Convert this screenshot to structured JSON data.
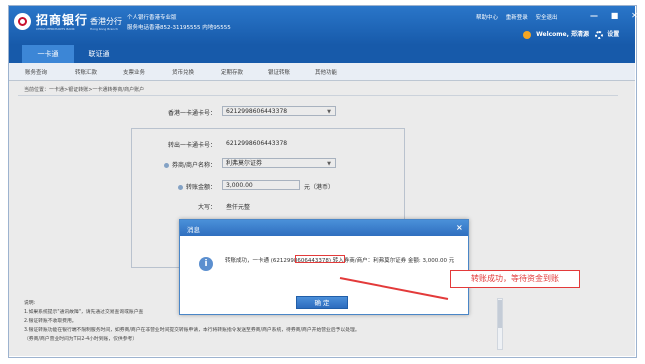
{
  "header": {
    "bank_name": "招商银行",
    "bank_name_en": "CHINA MERCHANTS BANK",
    "branch": "香港分行",
    "branch_en": "Hong Kong Branch",
    "portal_title": "个人银行香港专业版",
    "hotline": "服务电话香港852-31195555 内地95555",
    "top_links": [
      "帮助中心",
      "重新登录",
      "安全退出"
    ],
    "window_controls": "— ■ ✕",
    "welcome": "Welcome,",
    "user_name": "郑清源",
    "settings_label": "设置"
  },
  "tabs": {
    "main": [
      "一卡通",
      "联证通"
    ]
  },
  "subnav": {
    "items": [
      "账务查询",
      "转账汇款",
      "支票业务",
      "货币兑换",
      "定期存款",
      "银证转账",
      "其他功能"
    ]
  },
  "breadcrumb": "当前位置：一卡通>银证转账>一卡通转券商/商户账户",
  "form": {
    "card_label": "香港一卡通卡号：",
    "card_value": "6212998606443378",
    "out_card_label": "转出一卡通卡号：",
    "out_card_value": "6212998606443378",
    "broker_label": "券商/商户名称：",
    "broker_value": "利弗莫尔证券",
    "amount_label": "转账金额：",
    "amount_value": "3,000.00",
    "amount_unit": "元（港币）",
    "uppercase_label": "大写：",
    "uppercase_value": "叁仟元整"
  },
  "modal": {
    "title": "消息",
    "message": "转账成功，一卡通 (6212998606443378) 转入券商/商户：利弗莫尔证券 金额: 3,000.00 元",
    "ok_label": "确  定"
  },
  "callout": {
    "text": "转账成功，等待资金到账"
  },
  "notes": {
    "title": "说明:",
    "lines": [
      "1.如果系统提示\"通讯故障\"，请先通过交易查询或账户查",
      "2.银证转账不收取费用。",
      "3.银证转账功能在银行端不限制服务时间，如券商/商户在非营业时间提交转账申请，本行将转账指令发送至券商/商户系统，待券商/商户开始营业后予以处理。",
      "（券商/商户营业时间为T日2-4小时到账，仅供参考）"
    ]
  }
}
